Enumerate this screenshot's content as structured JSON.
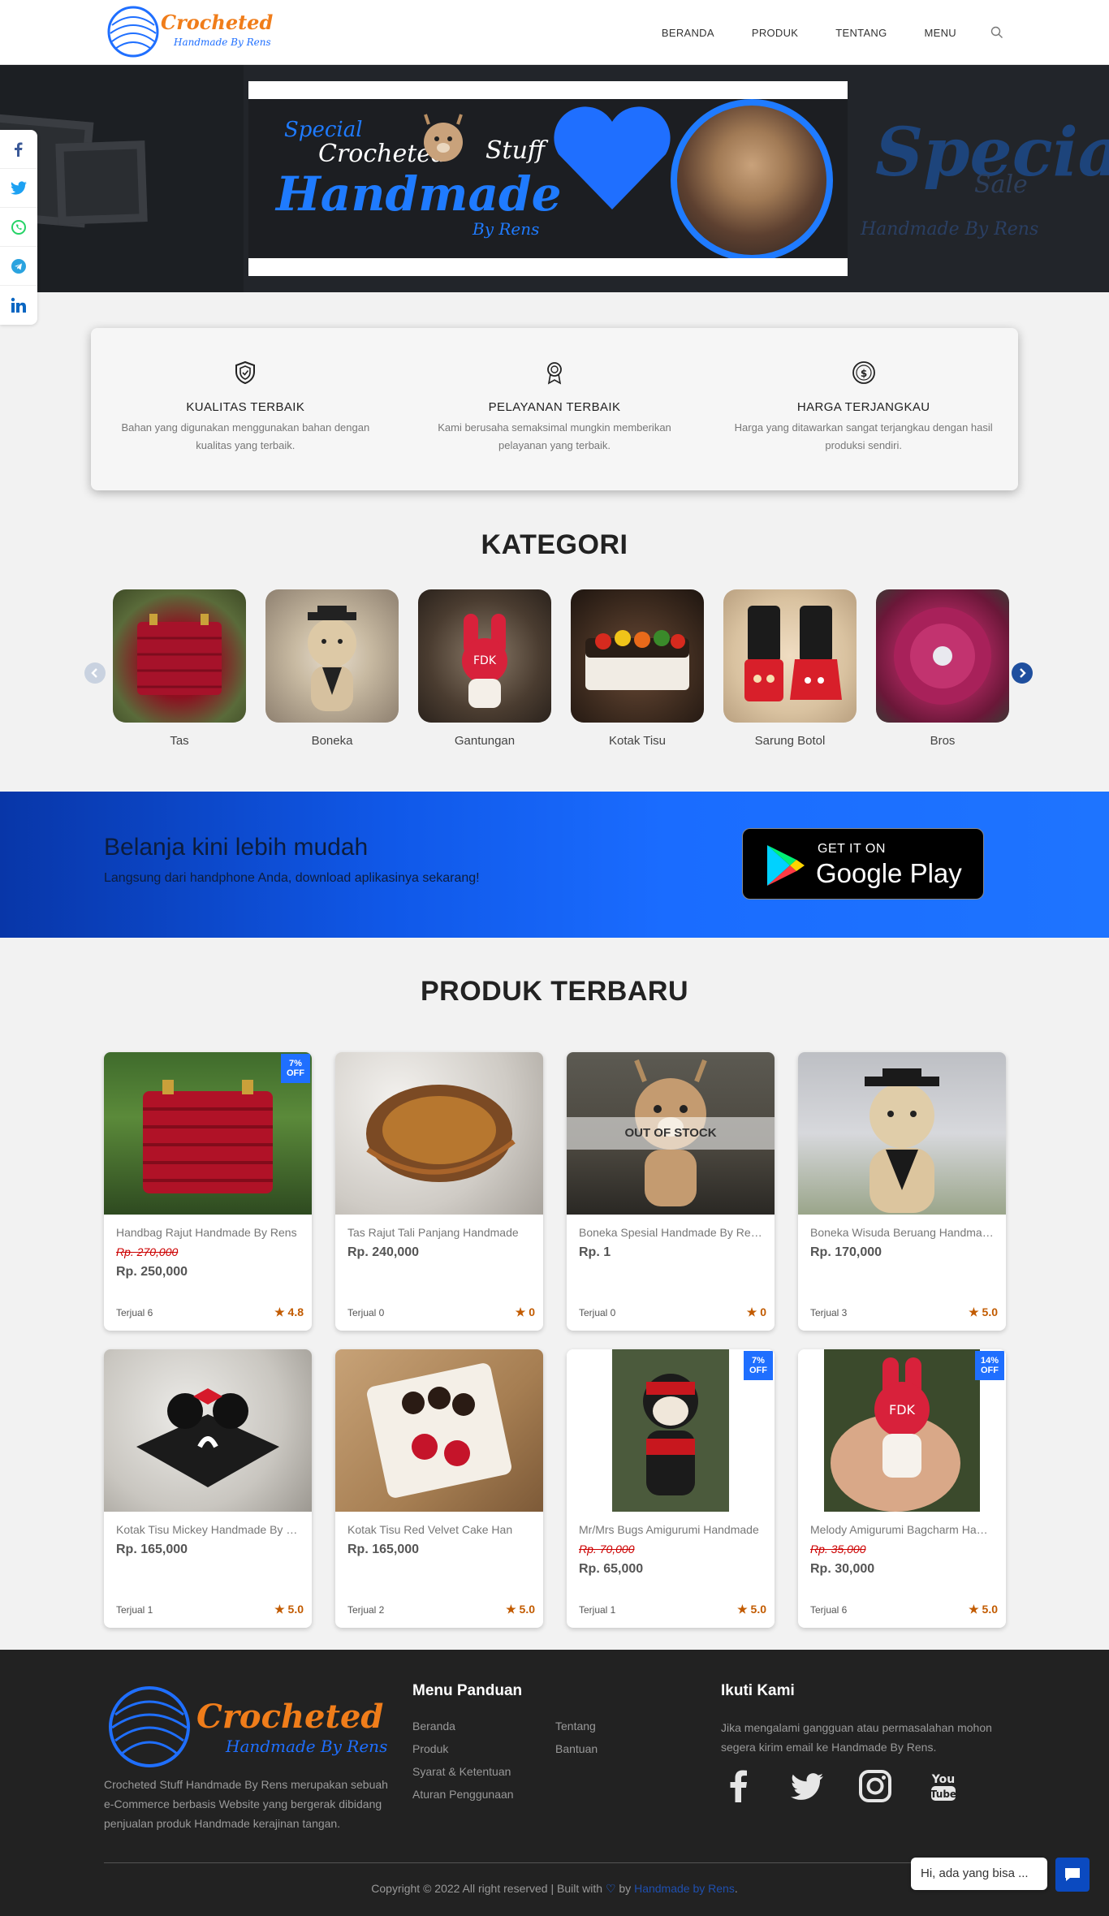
{
  "nav": {
    "items": [
      "BERANDA",
      "PRODUK",
      "TENTANG",
      "MENU"
    ],
    "search_icon": "search-icon"
  },
  "brand": {
    "logo_text": "Crocheted Stuff",
    "logo_sub": "Handmade By Rens",
    "primary": "#1f6fff",
    "orange": "#f07d1a"
  },
  "hero": {
    "banner_special": "Special",
    "banner_crocheted": "Crocheted",
    "banner_stuff": "Stuff",
    "banner_handmade": "Handmade",
    "banner_by": "By Rens",
    "right_special": "Special",
    "right_sale": "Sale",
    "right_sub": "Handmade By Rens"
  },
  "social": [
    "facebook-icon",
    "twitter-icon",
    "whatsapp-icon",
    "telegram-icon",
    "linkedin-icon"
  ],
  "features": [
    {
      "icon": "shield-icon",
      "title": "KUALITAS TERBAIK",
      "desc": "Bahan yang digunakan menggunakan bahan dengan kualitas yang terbaik."
    },
    {
      "icon": "award-icon",
      "title": "PELAYANAN TERBAIK",
      "desc": "Kami berusaha semaksimal mungkin memberikan pelayanan yang terbaik."
    },
    {
      "icon": "dollar-icon",
      "title": "HARGA TERJANGKAU",
      "desc": "Harga yang ditawarkan sangat terjangkau dengan hasil produksi sendiri."
    }
  ],
  "kategori": {
    "title": "KATEGORI",
    "items": [
      "Tas",
      "Boneka",
      "Gantungan",
      "Kotak Tisu",
      "Sarung Botol",
      "Bros"
    ]
  },
  "app": {
    "headline": "Belanja kini lebih mudah",
    "sub": "Langsung dari handphone Anda, download aplikasinya sekarang!",
    "get_it_on": "GET IT ON",
    "google_play": "Google Play"
  },
  "produk": {
    "title": "PRODUK TERBARU",
    "out_of_stock": "OUT OF STOCK",
    "items": [
      {
        "name": "Handbag Rajut Handmade By Rens",
        "old": "Rp. 270,000",
        "price": "Rp. 250,000",
        "sold": "Terjual 6",
        "rating": "4.8",
        "badge": "7% OFF"
      },
      {
        "name": "Tas Rajut Tali Panjang Handmade",
        "old": "",
        "price": "Rp. 240,000",
        "sold": "Terjual 0",
        "rating": "0",
        "badge": ""
      },
      {
        "name": "Boneka Spesial Handmade By Rens",
        "old": "",
        "price": "Rp. 1",
        "sold": "Terjual 0",
        "rating": "0",
        "badge": ""
      },
      {
        "name": "Boneka Wisuda Beruang Handmade",
        "old": "",
        "price": "Rp. 170,000",
        "sold": "Terjual 3",
        "rating": "5.0",
        "badge": ""
      },
      {
        "name": "Kotak Tisu Mickey Handmade By Rens",
        "old": "",
        "price": "Rp. 165,000",
        "sold": "Terjual 1",
        "rating": "5.0",
        "badge": ""
      },
      {
        "name": "Kotak Tisu Red Velvet Cake Han",
        "old": "",
        "price": "Rp. 165,000",
        "sold": "Terjual 2",
        "rating": "5.0",
        "badge": ""
      },
      {
        "name": "Mr/Mrs Bugs Amigurumi Handmade",
        "old": "Rp. 70,000",
        "price": "Rp. 65,000",
        "sold": "Terjual 1",
        "rating": "5.0",
        "badge": "7% OFF"
      },
      {
        "name": "Melody Amigurumi Bagcharm Handmade",
        "old": "Rp. 35,000",
        "price": "Rp. 30,000",
        "sold": "Terjual 6",
        "rating": "5.0",
        "badge": "14% OFF"
      }
    ]
  },
  "footer": {
    "about": "Crocheted Stuff Handmade By Rens merupakan sebuah e-Commerce berbasis Website yang bergerak dibidang penjualan produk Handmade kerajinan tangan.",
    "menu_title": "Menu Panduan",
    "menu_col1": [
      "Beranda",
      "Produk",
      "Syarat & Ketentuan",
      "Aturan Penggunaan"
    ],
    "menu_col2": [
      "Tentang",
      "Bantuan"
    ],
    "follow_title": "Ikuti Kami",
    "follow_text": "Jika mengalami gangguan atau permasalahan mohon segera kirim email ke Handmade By Rens.",
    "icons": [
      "facebook-icon",
      "twitter-icon",
      "instagram-icon",
      "youtube-icon"
    ],
    "copy_pre": "Copyright © 2022 All right reserved | Built with",
    "copy_by": "by",
    "copy_link": "Handmade by Rens",
    "copy_end": "."
  },
  "chat": {
    "bubble": "Hi, ada yang bisa ..."
  }
}
